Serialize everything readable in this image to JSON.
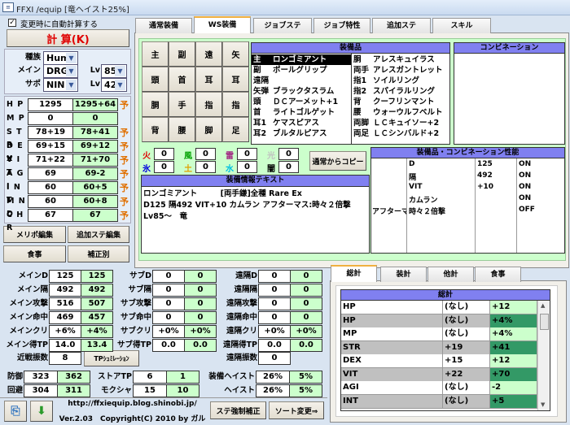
{
  "window": {
    "title": "FFXI /equip [竜ヘイスト25%]",
    "icon": "app-icon"
  },
  "left": {
    "auto_calc": {
      "label": "変更時に自動計算する",
      "checked": true
    },
    "calc_button": "計 算(K)",
    "race": {
      "label": "種族",
      "value": "Hum"
    },
    "main": {
      "label": "メイン",
      "value": "DRG",
      "lv_label": "Lv",
      "lv": "85"
    },
    "sub": {
      "label": "サポ",
      "value": "NIN",
      "lv_label": "Lv",
      "lv": "42"
    },
    "stats": [
      {
        "name": "H P",
        "base": "1295",
        "total": "1295+64",
        "mark": "予"
      },
      {
        "name": "M P",
        "base": "0",
        "total": "0",
        "mark": ""
      },
      {
        "name": "S T R",
        "base": "78+19",
        "total": "78+41",
        "mark": "予"
      },
      {
        "name": "D E X",
        "base": "69+15",
        "total": "69+12",
        "mark": "予"
      },
      {
        "name": "V I T",
        "base": "71+22",
        "total": "71+70",
        "mark": "予"
      },
      {
        "name": "A G I",
        "base": "69",
        "total": "69-2",
        "mark": "予"
      },
      {
        "name": "I N T",
        "base": "60",
        "total": "60+5",
        "mark": "予"
      },
      {
        "name": "M N D",
        "base": "60",
        "total": "60+8",
        "mark": "予"
      },
      {
        "name": "C H R",
        "base": "67",
        "total": "67",
        "mark": "予"
      }
    ],
    "buttons": [
      "メリポ編集",
      "追加ステ編集",
      "食事",
      "補正別"
    ]
  },
  "tabs": [
    "通常装備",
    "WS装備",
    "ジョブステ",
    "ジョブ特性",
    "追加ステ",
    "スキル"
  ],
  "active_tab": "WS装備",
  "slots": [
    "主",
    "副",
    "遠",
    "矢",
    "頭",
    "首",
    "耳",
    "耳",
    "胴",
    "手",
    "指",
    "指",
    "背",
    "腰",
    "脚",
    "足"
  ],
  "equipment": {
    "header": "装備品",
    "left": [
      [
        "主",
        "ロンゴミアント"
      ],
      [
        "副",
        "ポールグリップ"
      ],
      [
        "遠隔",
        ""
      ],
      [
        "矢弾",
        "ブラックタスラム"
      ],
      [
        "頭",
        "ＤＣアーメット+1"
      ],
      [
        "首",
        "ライトゴルゲット"
      ],
      [
        "耳1",
        "ケマスピアス"
      ],
      [
        "耳2",
        "ブルタルピアス"
      ]
    ],
    "right": [
      [
        "胴",
        "アレスキュイラス"
      ],
      [
        "両手",
        "アレスガントレット"
      ],
      [
        "指1",
        "ソイルリング"
      ],
      [
        "指2",
        "スパイラルリング"
      ],
      [
        "背",
        "クーフリンマント"
      ],
      [
        "腰",
        "ウォーウルフベルト"
      ],
      [
        "両脚",
        "ＬＣキュイソー+2"
      ],
      [
        "両足",
        "ＬＣシンバルド+2"
      ]
    ],
    "selected": 0
  },
  "combination": {
    "header": "コンビネーション"
  },
  "elements": [
    {
      "name": "火",
      "value": "0",
      "color": "#e00000"
    },
    {
      "name": "風",
      "value": "0",
      "color": "#00a000"
    },
    {
      "name": "雷",
      "value": "0",
      "color": "#a02080"
    },
    {
      "name": "光",
      "value": "0",
      "color": "#c0c0c0"
    },
    {
      "name": "氷",
      "value": "0",
      "color": "#0000e0"
    },
    {
      "name": "土",
      "value": "0",
      "color": "#e0a000"
    },
    {
      "name": "水",
      "value": "0",
      "color": "#00c0e0"
    },
    {
      "name": "闇",
      "value": "0",
      "color": "#000000"
    }
  ],
  "copy_button": "通常からコピー",
  "info_text": {
    "header": "装備情報テキスト",
    "lines": [
      "ロンゴミアント　　　[両手鎌]全種 Rare Ex",
      "D125 隔492 VIT+10 カムラン アフターマス:時々２倍撃",
      "Lv85～　竜"
    ]
  },
  "performance": {
    "header": "装備品・コンビネーション性能",
    "rows": [
      [
        "",
        "D",
        "125",
        "ON"
      ],
      [
        "",
        "隔",
        "492",
        "ON"
      ],
      [
        "",
        "VIT",
        "+10",
        "ON"
      ],
      [
        "",
        "カムラン",
        "",
        "ON"
      ],
      [
        "アフターマ",
        "時々２倍撃",
        "",
        "OFF"
      ]
    ]
  },
  "battle": {
    "main": [
      [
        "メインD",
        "125",
        "125"
      ],
      [
        "メイン隔",
        "492",
        "492"
      ],
      [
        "メイン攻撃",
        "516",
        "507"
      ],
      [
        "メイン命中",
        "469",
        "457"
      ],
      [
        "メインクリ",
        "+6%",
        "+4%"
      ],
      [
        "メイン得TP",
        "14.0",
        "13.4"
      ]
    ],
    "sub": [
      [
        "サブD",
        "0",
        "0"
      ],
      [
        "サブ隔",
        "0",
        "0"
      ],
      [
        "サブ攻撃",
        "0",
        "0"
      ],
      [
        "サブ命中",
        "0",
        "0"
      ],
      [
        "サブクリ",
        "+0%",
        "+0%"
      ],
      [
        "サブ得TP",
        "0.0",
        "0.0"
      ]
    ],
    "ranged": [
      [
        "遠隔D",
        "0",
        "0"
      ],
      [
        "遠隔隔",
        "0",
        "0"
      ],
      [
        "遠隔攻撃",
        "0",
        "0"
      ],
      [
        "遠隔命中",
        "0",
        "0"
      ],
      [
        "遠隔クリ",
        "+0%",
        "+0%"
      ],
      [
        "遠隔得TP",
        "0.0",
        "0.0"
      ]
    ],
    "melee_swings": {
      "label": "近戦振数",
      "value": "8"
    },
    "tp_sim_button": "TPｼｭﾐﾚｰｼｮﾝ",
    "ranged_swings": {
      "label": "遠隔振数",
      "value": "0"
    },
    "bottom": [
      [
        [
          "防御",
          "323",
          "362"
        ],
        [
          "ストアTP",
          "6",
          "1"
        ],
        [
          "装備ヘイスト",
          "26%",
          "5%"
        ]
      ],
      [
        [
          "回避",
          "304",
          "311"
        ],
        [
          "モクシャ",
          "15",
          "10"
        ],
        [
          "ヘイスト",
          "26%",
          "5%"
        ]
      ]
    ]
  },
  "footer": {
    "url": "http://ffxiequip.blog.shinobi.jp/",
    "version": "Ver.2.03　Copyright(C) 2010 by ガル",
    "buttons": [
      "ステ強制補正",
      "ソート変更⇒"
    ],
    "icons": [
      "save-icon",
      "load-icon"
    ]
  },
  "summary": {
    "tabs": [
      "総計",
      "装計",
      "他計",
      "食事"
    ],
    "active_tab": "総計",
    "header": "総計",
    "rows": [
      [
        "HP",
        "(なし)",
        "+12"
      ],
      [
        "HP",
        "(なし)",
        "+4%"
      ],
      [
        "MP",
        "(なし)",
        "+4%"
      ],
      [
        "STR",
        "+19",
        "+41"
      ],
      [
        "DEX",
        "+15",
        "+12"
      ],
      [
        "VIT",
        "+22",
        "+70"
      ],
      [
        "AGI",
        "(なし)",
        "-2"
      ],
      [
        "INT",
        "(なし)",
        "+5"
      ]
    ]
  },
  "colors": {
    "header": "#8080f0",
    "green_cell": "#ccffcc",
    "dark_green": "#339966",
    "gray_row": "#c0c0c0",
    "calc_text": "#e00000"
  }
}
